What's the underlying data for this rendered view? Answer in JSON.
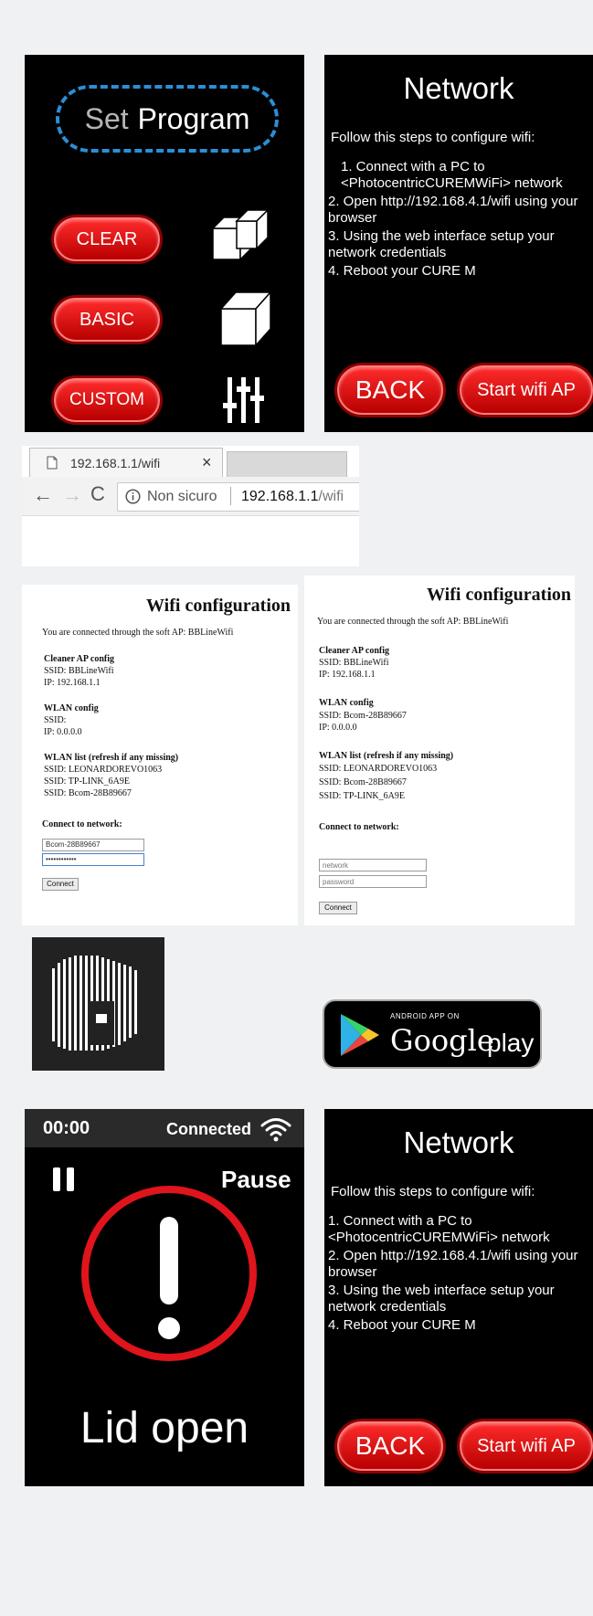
{
  "program_panel": {
    "title_word1": "Set",
    "title_word2": "Program",
    "buttons": [
      "CLEAR",
      "BASIC",
      "CUSTOM"
    ]
  },
  "network_panel": {
    "title": "Network",
    "intro": "Follow this steps to configure wifi:",
    "steps": [
      "1. Connect with a PC to <PhotocentricCUREMWiFi> network",
      "2. Open http://192.168.4.1/wifi using your browser",
      "3. Using the web interface setup your network credentials",
      "4. Reboot your CURE M"
    ],
    "back_label": "BACK",
    "start_label": "Start wifi AP"
  },
  "browser": {
    "tab_title": "192.168.1.1/wifi",
    "close": "×",
    "not_secure": "Non sicuro",
    "url_host": "192.168.1.1",
    "url_path": "/wifi"
  },
  "wifi_left": {
    "heading": "Wifi configuration",
    "connected_via": "You are connected through the soft AP: BBLineWifi",
    "cleaner_title": "Cleaner AP config",
    "cleaner_ssid": "SSID: BBLineWifi",
    "cleaner_ip": "IP: 192.168.1.1",
    "wlan_title": "WLAN config",
    "wlan_ssid": "SSID:",
    "wlan_ip": "IP: 0.0.0.0",
    "list_title": "WLAN list (refresh if any missing)",
    "list": [
      "SSID: LEONARDOREVO1063",
      "SSID: TP-LINK_6A9E",
      "SSID: Bcom-28B89667"
    ],
    "connect_title": "Connect to network:",
    "network_value": "Bcom-28B89667",
    "password_value": "••••••••••••",
    "connect_button": "Connect"
  },
  "wifi_right": {
    "heading": "Wifi configuration",
    "connected_via": "You are connected through the soft AP: BBLineWifi",
    "cleaner_title": "Cleaner AP config",
    "cleaner_ssid": "SSID: BBLineWifi",
    "cleaner_ip": "IP: 192.168.1.1",
    "wlan_title": "WLAN config",
    "wlan_ssid": "SSID: Bcom-28B89667",
    "wlan_ip": "IP: 0.0.0.0",
    "list_title": "WLAN list (refresh if any missing)",
    "list": [
      "SSID: LEONARDOREVO1063",
      "SSID: Bcom-28B89667",
      "SSID: TP-LINK_6A9E"
    ],
    "connect_title": "Connect to network:",
    "network_placeholder": "network",
    "password_placeholder": "password",
    "connect_button": "Connect"
  },
  "google_play": {
    "small": "ANDROID APP ON",
    "brand": "Google",
    "word": "play"
  },
  "status_screen": {
    "time": "00:00",
    "connection": "Connected",
    "pause_label": "Pause",
    "message": "Lid open"
  },
  "network_panel_2": {
    "title": "Network",
    "intro": "Follow this steps to configure wifi:",
    "steps": [
      "1. Connect with a PC to <PhotocentricCUREMWiFi> network",
      "2. Open http://192.168.4.1/wifi using your browser",
      "3. Using the web interface setup your network credentials",
      "4. Reboot your CURE M"
    ],
    "back_label": "BACK",
    "start_label": "Start wifi AP"
  },
  "colors": {
    "accent_red": "#e0141c",
    "ring_blue": "#2a8fd6",
    "background": "#f0f1f3"
  }
}
